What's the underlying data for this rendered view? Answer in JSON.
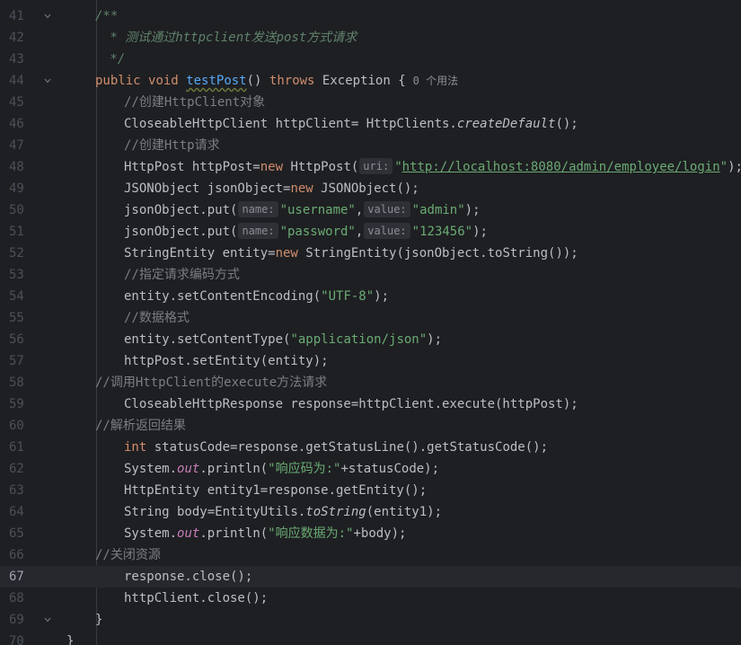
{
  "editor": {
    "current_line": "67",
    "lines": [
      {
        "num": "41",
        "tokens": [
          {
            "t": "/**",
            "c": "doc"
          }
        ]
      },
      {
        "num": "42",
        "tokens": [
          {
            "t": " * 测试通过httpclient发送post方式请求",
            "c": "doc"
          }
        ]
      },
      {
        "num": "43",
        "tokens": [
          {
            "t": " */",
            "c": "doc"
          }
        ]
      },
      {
        "num": "44",
        "tokens": [
          {
            "t": "public ",
            "c": "kw"
          },
          {
            "t": "void ",
            "c": "kw"
          },
          {
            "t": "testPost",
            "c": "fn-decl underline"
          },
          {
            "t": "() ",
            "c": "plain"
          },
          {
            "t": "throws ",
            "c": "kw"
          },
          {
            "t": "Exception {",
            "c": "plain"
          },
          {
            "t": "0 个用法",
            "c": "usages"
          }
        ]
      },
      {
        "num": "45",
        "tokens": [
          {
            "t": "//创建HttpClient对象",
            "c": "cmt"
          }
        ]
      },
      {
        "num": "46",
        "tokens": [
          {
            "t": "CloseableHttpClient httpClient= HttpClients.",
            "c": "plain"
          },
          {
            "t": "createDefault",
            "c": "static-fn"
          },
          {
            "t": "();",
            "c": "plain"
          }
        ]
      },
      {
        "num": "47",
        "tokens": [
          {
            "t": "//创建Http请求",
            "c": "cmt"
          }
        ]
      },
      {
        "num": "48",
        "tokens": [
          {
            "t": "HttpPost httpPost=",
            "c": "plain"
          },
          {
            "t": "new ",
            "c": "kw"
          },
          {
            "t": "HttpPost(",
            "c": "plain"
          },
          {
            "t": "uri:",
            "c": "hint"
          },
          {
            "t": "\"",
            "c": "str"
          },
          {
            "t": "http://localhost:8080/admin/employee/login",
            "c": "url"
          },
          {
            "t": "\"",
            "c": "str"
          },
          {
            "t": ");",
            "c": "plain"
          }
        ]
      },
      {
        "num": "49",
        "tokens": [
          {
            "t": "JSONObject jsonObject=",
            "c": "plain"
          },
          {
            "t": "new ",
            "c": "kw"
          },
          {
            "t": "JSONObject();",
            "c": "plain"
          }
        ]
      },
      {
        "num": "50",
        "tokens": [
          {
            "t": "jsonObject.put(",
            "c": "plain"
          },
          {
            "t": "name:",
            "c": "hint"
          },
          {
            "t": "\"username\"",
            "c": "str"
          },
          {
            "t": ",",
            "c": "plain"
          },
          {
            "t": "value:",
            "c": "hint"
          },
          {
            "t": "\"admin\"",
            "c": "str"
          },
          {
            "t": ");",
            "c": "plain"
          }
        ]
      },
      {
        "num": "51",
        "tokens": [
          {
            "t": "jsonObject.put(",
            "c": "plain"
          },
          {
            "t": "name:",
            "c": "hint"
          },
          {
            "t": "\"password\"",
            "c": "str"
          },
          {
            "t": ",",
            "c": "plain"
          },
          {
            "t": "value:",
            "c": "hint"
          },
          {
            "t": "\"123456\"",
            "c": "str"
          },
          {
            "t": ");",
            "c": "plain"
          }
        ]
      },
      {
        "num": "52",
        "tokens": [
          {
            "t": "StringEntity entity=",
            "c": "plain"
          },
          {
            "t": "new ",
            "c": "kw"
          },
          {
            "t": "StringEntity(jsonObject.toString());",
            "c": "plain"
          }
        ]
      },
      {
        "num": "53",
        "tokens": [
          {
            "t": "//指定请求编码方式",
            "c": "cmt"
          }
        ]
      },
      {
        "num": "54",
        "tokens": [
          {
            "t": "entity.setContentEncoding(",
            "c": "plain"
          },
          {
            "t": "\"UTF-8\"",
            "c": "str"
          },
          {
            "t": ");",
            "c": "plain"
          }
        ]
      },
      {
        "num": "55",
        "tokens": [
          {
            "t": "//数据格式",
            "c": "cmt"
          }
        ]
      },
      {
        "num": "56",
        "tokens": [
          {
            "t": "entity.setContentType(",
            "c": "plain"
          },
          {
            "t": "\"application/json\"",
            "c": "str"
          },
          {
            "t": ");",
            "c": "plain"
          }
        ]
      },
      {
        "num": "57",
        "tokens": [
          {
            "t": "httpPost.setEntity(entity);",
            "c": "plain"
          }
        ]
      },
      {
        "num": "58",
        "tokens": [
          {
            "t": "//调用HttpClient的execute方法请求",
            "c": "cmt"
          }
        ]
      },
      {
        "num": "59",
        "tokens": [
          {
            "t": "CloseableHttpResponse response=httpClient.execute(httpPost);",
            "c": "plain"
          }
        ]
      },
      {
        "num": "60",
        "tokens": [
          {
            "t": "//解析返回结果",
            "c": "cmt"
          }
        ]
      },
      {
        "num": "61",
        "tokens": [
          {
            "t": "int ",
            "c": "kw"
          },
          {
            "t": "statusCode=response.getStatusLine().getStatusCode();",
            "c": "plain"
          }
        ]
      },
      {
        "num": "62",
        "tokens": [
          {
            "t": "System.",
            "c": "plain"
          },
          {
            "t": "out",
            "c": "field"
          },
          {
            "t": ".println(",
            "c": "plain"
          },
          {
            "t": "\"响应码为:\"",
            "c": "str"
          },
          {
            "t": "+statusCode);",
            "c": "plain"
          }
        ]
      },
      {
        "num": "63",
        "tokens": [
          {
            "t": "HttpEntity entity1=response.getEntity();",
            "c": "plain"
          }
        ]
      },
      {
        "num": "64",
        "tokens": [
          {
            "t": "String body=EntityUtils.",
            "c": "plain"
          },
          {
            "t": "toString",
            "c": "static-fn"
          },
          {
            "t": "(entity1);",
            "c": "plain"
          }
        ]
      },
      {
        "num": "65",
        "tokens": [
          {
            "t": "System.",
            "c": "plain"
          },
          {
            "t": "out",
            "c": "field"
          },
          {
            "t": ".println(",
            "c": "plain"
          },
          {
            "t": "\"响应数据为:\"",
            "c": "str"
          },
          {
            "t": "+body);",
            "c": "plain"
          }
        ]
      },
      {
        "num": "66",
        "tokens": [
          {
            "t": "//关闭资源",
            "c": "cmt"
          }
        ]
      },
      {
        "num": "67",
        "tokens": [
          {
            "t": "response.close();",
            "c": "plain"
          }
        ]
      },
      {
        "num": "68",
        "tokens": [
          {
            "t": "httpClient.close();",
            "c": "plain"
          }
        ]
      },
      {
        "num": "69",
        "tokens": [
          {
            "t": "}",
            "c": "plain"
          }
        ]
      },
      {
        "num": "70",
        "tokens": [
          {
            "t": "}",
            "c": "plain"
          }
        ]
      }
    ]
  },
  "colors": {
    "background": "#1e1f22",
    "keyword": "#cf8e6d",
    "string": "#6aab73",
    "comment": "#7a7e85",
    "doc_comment": "#5f826b",
    "method_declaration": "#56a8f5",
    "static_field": "#c77dbb"
  },
  "icons": {
    "fold_open": "chevron-down-icon"
  }
}
